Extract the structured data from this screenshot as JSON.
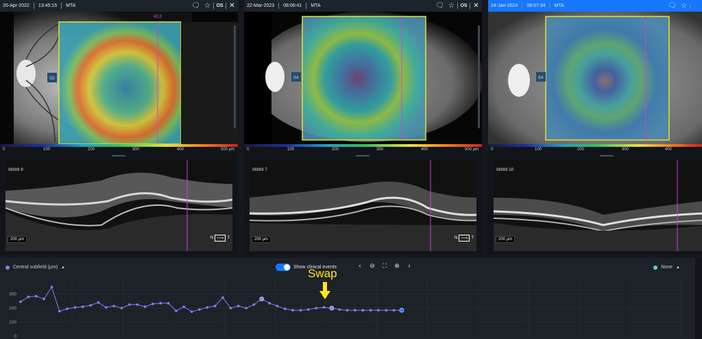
{
  "panels": [
    {
      "date": "20-Apr-2022",
      "time": "13:45:15",
      "mode": "MTA",
      "eye": "OS",
      "active": false,
      "box_label": "58",
      "marker": "413",
      "bscan_label": "IIIIIIIIII 9",
      "um": "200 µm",
      "nt_left": "N",
      "nt_right": "T",
      "show_nt": true
    },
    {
      "date": "22-Mar-2023",
      "time": "08:06:41",
      "mode": "MTA",
      "eye": "OS",
      "active": false,
      "box_label": "64",
      "marker": "",
      "bscan_label": "IIIIIIIIII 7",
      "um": "200 µm",
      "nt_left": "N",
      "nt_right": "T",
      "show_nt": true
    },
    {
      "date": "24-Jan-2024",
      "time": "08:57:34",
      "mode": "MTA",
      "eye": "",
      "active": true,
      "box_label": "64",
      "marker": "",
      "bscan_label": "IIIIIIIIII 10",
      "um": "200 µm",
      "nt_left": "",
      "nt_right": "",
      "show_nt": false
    }
  ],
  "scale_ticks": [
    "0",
    "100",
    "200",
    "300",
    "400",
    "500 µm"
  ],
  "trend": {
    "left_legend": "Central subfield (µm)",
    "toggle_label": "Show clinical events",
    "toggle_on": true,
    "right_legend": "None",
    "series_color": "#8b7ff5",
    "right_dot_color": "#4fd8d0",
    "accent": "#1677ff",
    "yticks": [
      "300",
      "200",
      "100",
      "0"
    ]
  },
  "annotation": "Swap",
  "chart_data": {
    "type": "line",
    "ylim": [
      0,
      400
    ],
    "yticks": [
      0,
      100,
      200,
      300
    ],
    "series": [
      {
        "values": [
          245,
          280,
          285,
          265,
          350,
          178,
          195,
          205,
          210,
          220,
          240,
          205,
          215,
          200,
          225,
          225,
          210,
          230,
          235,
          235,
          180,
          210,
          175,
          190,
          205,
          215,
          275,
          200,
          215,
          200,
          225,
          265,
          235,
          215,
          195,
          185,
          185,
          190,
          200,
          205,
          200,
          190,
          185,
          185,
          185,
          185,
          185,
          185,
          185,
          185
        ]
      }
    ]
  }
}
